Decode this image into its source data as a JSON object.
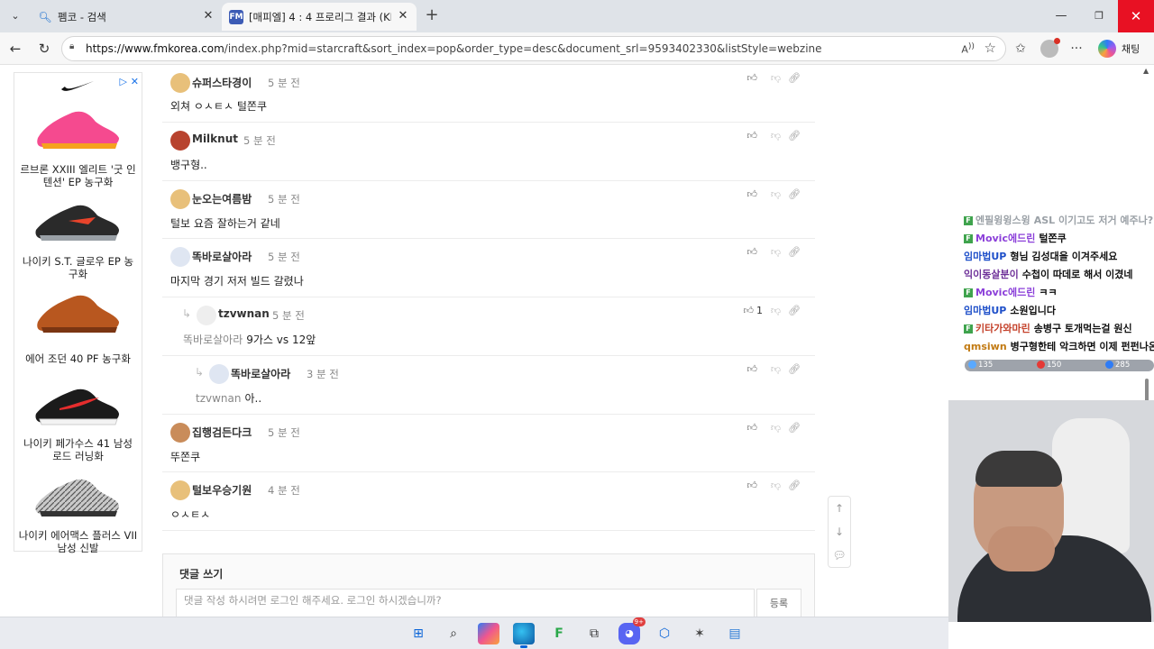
{
  "browser": {
    "tabs": [
      {
        "title": "펨코 - 검색",
        "icon": "search-icon"
      },
      {
        "title": "[매피엘] 4 : 4 프로리그 결과 (KRI그",
        "favicon_text": "FM"
      }
    ],
    "url_host": "https://www.fmkorea.com",
    "url_path": "/index.php?mid=starcraft&sort_index=pop&order_type=desc&document_srl=9593402330&listStyle=webzine",
    "chat_label": "채팅",
    "read_aloud_label": "A "
  },
  "ad": {
    "items": [
      {
        "name": "르브론 XXIII 엘리트 '굿 인텐션' EP 농구화",
        "colors": [
          "#f54a8f",
          "#f5a21e"
        ]
      },
      {
        "name": "나이키 S.T. 글로우 EP 농구화",
        "colors": [
          "#2a2a2a",
          "#e8442b"
        ]
      },
      {
        "name": "에어 조던 40 PF 농구화",
        "colors": [
          "#b8571f",
          "#7a3512"
        ]
      },
      {
        "name": "나이키 페가수스 41 남성 로드 러닝화",
        "colors": [
          "#1b1b1b",
          "#e52d2d"
        ]
      },
      {
        "name": "나이키 에어맥스 플러스 VII 남성 신발",
        "colors": [
          "#c9c9c9",
          "#333333"
        ]
      }
    ]
  },
  "comments": [
    {
      "author": "슈퍼스타경이",
      "time": "5 분 전",
      "text": "외쳐 ㅇㅅㅌㅅ 털쫀쿠",
      "avatar": "dog"
    },
    {
      "author": "Milknut",
      "time": "5 분 전",
      "text": "뱅구형..",
      "avatar": "red"
    },
    {
      "author": "눈오는여름밤",
      "time": "5 분 전",
      "text": "털보 요즘 잘하는거 같네",
      "avatar": "dog"
    },
    {
      "author": "똑바로살아라",
      "time": "5 분 전",
      "text": "마지막 경기 저저 빌드 갈렸나",
      "avatar": "white"
    },
    {
      "author": "tzvwnan",
      "time": "5 분 전",
      "reply_to": "똑바로살아라",
      "text": "9가스 vs 12앞",
      "avatar": "white",
      "upvotes": "1"
    },
    {
      "author": "똑바로살아라",
      "time": "3 분 전",
      "reply_to": "tzvwnan",
      "text": "아..",
      "avatar": "white"
    },
    {
      "author": "집행검든다크",
      "time": "5 분 전",
      "text": "뚜쫀쿠",
      "avatar": "dog"
    },
    {
      "author": "털보우승기원",
      "time": "4 분 전",
      "text": "ㅇㅅㅌㅅ",
      "avatar": "dog"
    }
  ],
  "write": {
    "title": "댓글 쓰기",
    "placeholder": "댓글 작성 하시려면 로그인 해주세요. 로그인 하시겠습니까?",
    "submit": "등록"
  },
  "stream_chat": {
    "lines": [
      {
        "nick": "엔필윙윙스윙",
        "msg": "ASL 이기고도 저거 예주나?",
        "color": "#d8d8d8",
        "badge": true
      },
      {
        "nick": "Movic에드린",
        "msg": "털쫀쿠",
        "color": "#8b3fd9",
        "badge": true
      },
      {
        "nick": "임마법UP",
        "msg": "형님 김성대을 이겨주세요",
        "color": "#1e4fc9",
        "badge": false
      },
      {
        "nick": "익이동살분이",
        "msg": "수첩이 따데로 해서 이겼네",
        "color": "#6d2f98",
        "badge": false
      },
      {
        "nick": "Movic에드린",
        "msg": "ㅋㅋ",
        "color": "#8b3fd9",
        "badge": true
      },
      {
        "nick": "임마법UP",
        "msg": "소원입니다",
        "color": "#1e4fc9",
        "badge": false
      },
      {
        "nick": "키타가와마린",
        "msg": "송병구 토개먹는걸 원신",
        "color": "#c4412a",
        "badge": true
      },
      {
        "nick": "qmsiwn",
        "msg": "병구형한테 악크하면 이제 펀펀나온다",
        "color": "#c27a12",
        "badge": false
      }
    ],
    "stats": [
      {
        "value": "135",
        "color": "#5aa9ff"
      },
      {
        "value": "150",
        "color": "#e53935"
      },
      {
        "value": "285",
        "color": "#2f7cf6"
      }
    ]
  },
  "taskbar": {
    "apps": [
      "windows-start-icon",
      "search-icon",
      "copilot-icon",
      "edge-icon",
      "fmkorea-icon",
      "snip-icon",
      "discord-icon",
      "app-icon",
      "game-icon",
      "notepad-icon"
    ],
    "discord_badge": "9+"
  }
}
